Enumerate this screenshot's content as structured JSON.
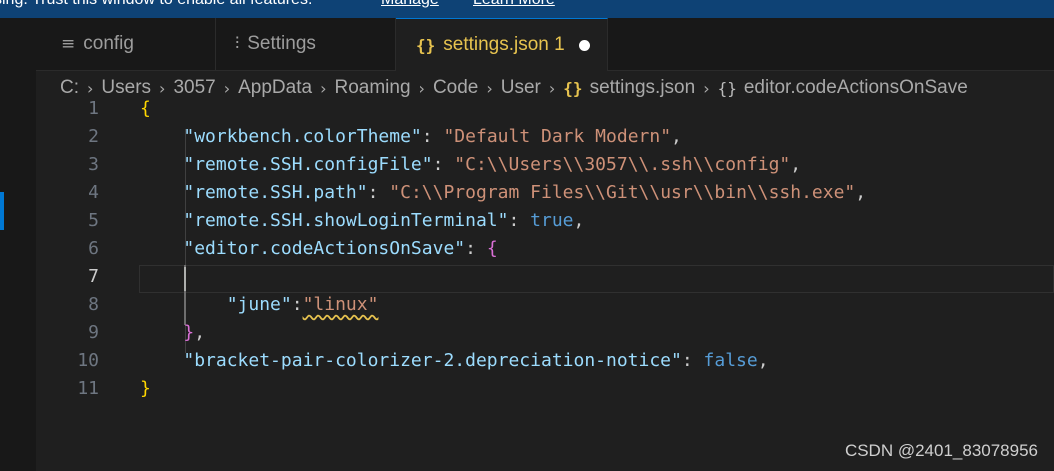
{
  "banner": {
    "message": "sing. Trust this window to enable all features.",
    "manage_link": "Manage",
    "learn_more_link": "Learn More"
  },
  "tabs": [
    {
      "label": "config",
      "icon": "lines-icon",
      "active": false
    },
    {
      "label": "Settings",
      "icon": "sliders-icon",
      "active": false
    },
    {
      "label": "settings.json 1",
      "icon": "json-icon",
      "active": true,
      "dirty": true
    }
  ],
  "breadcrumb": {
    "segments": [
      "C:",
      "Users",
      "3057",
      "AppData",
      "Roaming",
      "Code",
      "User"
    ],
    "file": "settings.json",
    "file_icon": "{}",
    "symbol": "editor.codeActionsOnSave",
    "symbol_icon": "{}"
  },
  "editor": {
    "current_line": 7,
    "lines": [
      {
        "num": "1",
        "tokens": [
          [
            "b1",
            "{"
          ]
        ]
      },
      {
        "num": "2",
        "tokens": [
          [
            "p",
            "    "
          ],
          [
            "k",
            "\"workbench.colorTheme\""
          ],
          [
            "p",
            ": "
          ],
          [
            "s",
            "\"Default Dark Modern\""
          ],
          [
            "p",
            ","
          ]
        ]
      },
      {
        "num": "3",
        "tokens": [
          [
            "p",
            "    "
          ],
          [
            "k",
            "\"remote.SSH.configFile\""
          ],
          [
            "p",
            ": "
          ],
          [
            "s",
            "\"C:\\\\Users\\\\3057\\\\.ssh\\\\config\""
          ],
          [
            "p",
            ","
          ]
        ]
      },
      {
        "num": "4",
        "tokens": [
          [
            "p",
            "    "
          ],
          [
            "k",
            "\"remote.SSH.path\""
          ],
          [
            "p",
            ": "
          ],
          [
            "s",
            "\"C:\\\\Program Files\\\\Git\\\\usr\\\\bin\\\\ssh.exe\""
          ],
          [
            "p",
            ","
          ]
        ]
      },
      {
        "num": "5",
        "tokens": [
          [
            "p",
            "    "
          ],
          [
            "k",
            "\"remote.SSH.showLoginTerminal\""
          ],
          [
            "p",
            ": "
          ],
          [
            "kw",
            "true"
          ],
          [
            "p",
            ","
          ]
        ]
      },
      {
        "num": "6",
        "tokens": [
          [
            "p",
            "    "
          ],
          [
            "k",
            "\"editor.codeActionsOnSave\""
          ],
          [
            "p",
            ": "
          ],
          [
            "b2",
            "{"
          ]
        ]
      },
      {
        "num": "7",
        "tokens": []
      },
      {
        "num": "8",
        "tokens": [
          [
            "p",
            "        "
          ],
          [
            "k",
            "\"june\""
          ],
          [
            "p",
            ":"
          ],
          [
            "s squiggle",
            "\"linux\""
          ]
        ]
      },
      {
        "num": "9",
        "tokens": [
          [
            "p",
            "    "
          ],
          [
            "b2",
            "}"
          ],
          [
            "p",
            ","
          ]
        ]
      },
      {
        "num": "10",
        "tokens": [
          [
            "p",
            "    "
          ],
          [
            "k",
            "\"bracket-pair-colorizer-2.depreciation-notice\""
          ],
          [
            "p",
            ": "
          ],
          [
            "kw",
            "false"
          ],
          [
            "p",
            ","
          ]
        ]
      },
      {
        "num": "11",
        "tokens": [
          [
            "b1",
            "}"
          ]
        ]
      }
    ]
  },
  "watermark": "CSDN @2401_83078956",
  "colors": {
    "banner_bg": "#0e4275",
    "editor_bg": "#1f1f1f",
    "key": "#9cdcfe",
    "string": "#ce9178",
    "keyword": "#569cd6",
    "bracket_level1": "#ffd700",
    "bracket_level2": "#da70d6",
    "accent": "#0078d4"
  }
}
